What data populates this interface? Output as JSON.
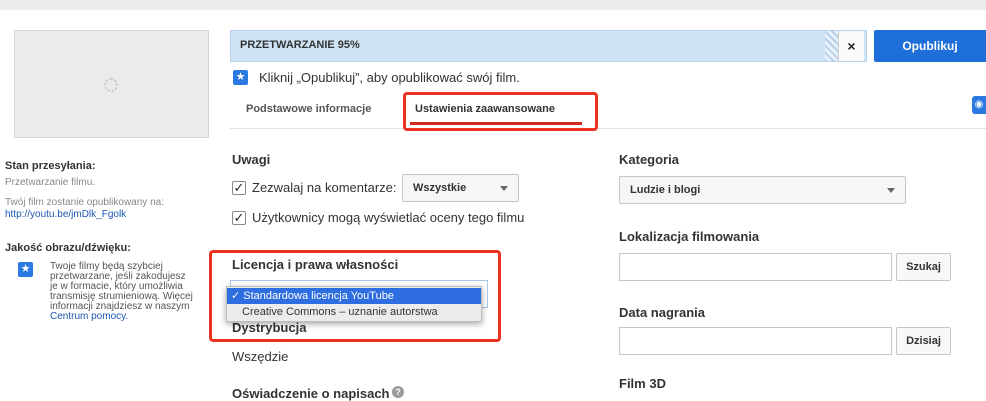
{
  "upload_status": {
    "label": "Stan przesyłania:",
    "value": "Przetwarzanie filmu.",
    "url_note": "Twój film zostanie opublikowany na:",
    "url": "http://youtu.be/jmDlk_Fgolk"
  },
  "quality": {
    "label": "Jakość obrazu/dźwięku:",
    "lines": [
      "Twoje filmy będą szybciej",
      "przetwarzane, jeśli zakodujesz",
      "je w formacie, który umożliwia",
      "transmisję strumieniową. Więcej",
      "informacji znajdziesz w naszym"
    ],
    "help_link": "Centrum pomocy."
  },
  "progress": {
    "label": "PRZETWARZANIE 95%",
    "percent": 95
  },
  "close_glyph": "×",
  "publish_label": "Opublikuj",
  "hint": "Kliknij „Opublikuj”, aby opublikować swój film.",
  "star_glyph": "★",
  "tabs": [
    {
      "label": "Podstawowe informacje",
      "active": false
    },
    {
      "label": "Ustawienia zaawansowane",
      "active": true
    }
  ],
  "comments": {
    "title": "Uwagi",
    "allow_label": "Zezwalaj na komentarze:",
    "allow_value": "Wszystkie",
    "ratings_label": "Użytkownicy mogą wyświetlać oceny tego filmu",
    "check_glyph": "✓"
  },
  "license": {
    "title": "Licencja i prawa własności",
    "options": [
      "Standardowa licencja YouTube",
      "Creative Commons – uznanie autorstwa"
    ],
    "selected_glyph": "✓"
  },
  "distribution": {
    "title": "Dystrybucja",
    "value": "Wszędzie"
  },
  "captions": {
    "title": "Oświadczenie o napisach",
    "help_glyph": "?"
  },
  "category": {
    "title": "Kategoria",
    "value": "Ludzie i blogi"
  },
  "location": {
    "title": "Lokalizacja filmowania",
    "button": "Szukaj"
  },
  "record_date": {
    "title": "Data nagrania",
    "button": "Dzisiaj"
  },
  "film3d": {
    "title": "Film 3D"
  },
  "colors": {
    "accent": "#1e6fd9",
    "highlight": "#ea3323",
    "progress_bg": "#cfe3f7"
  }
}
